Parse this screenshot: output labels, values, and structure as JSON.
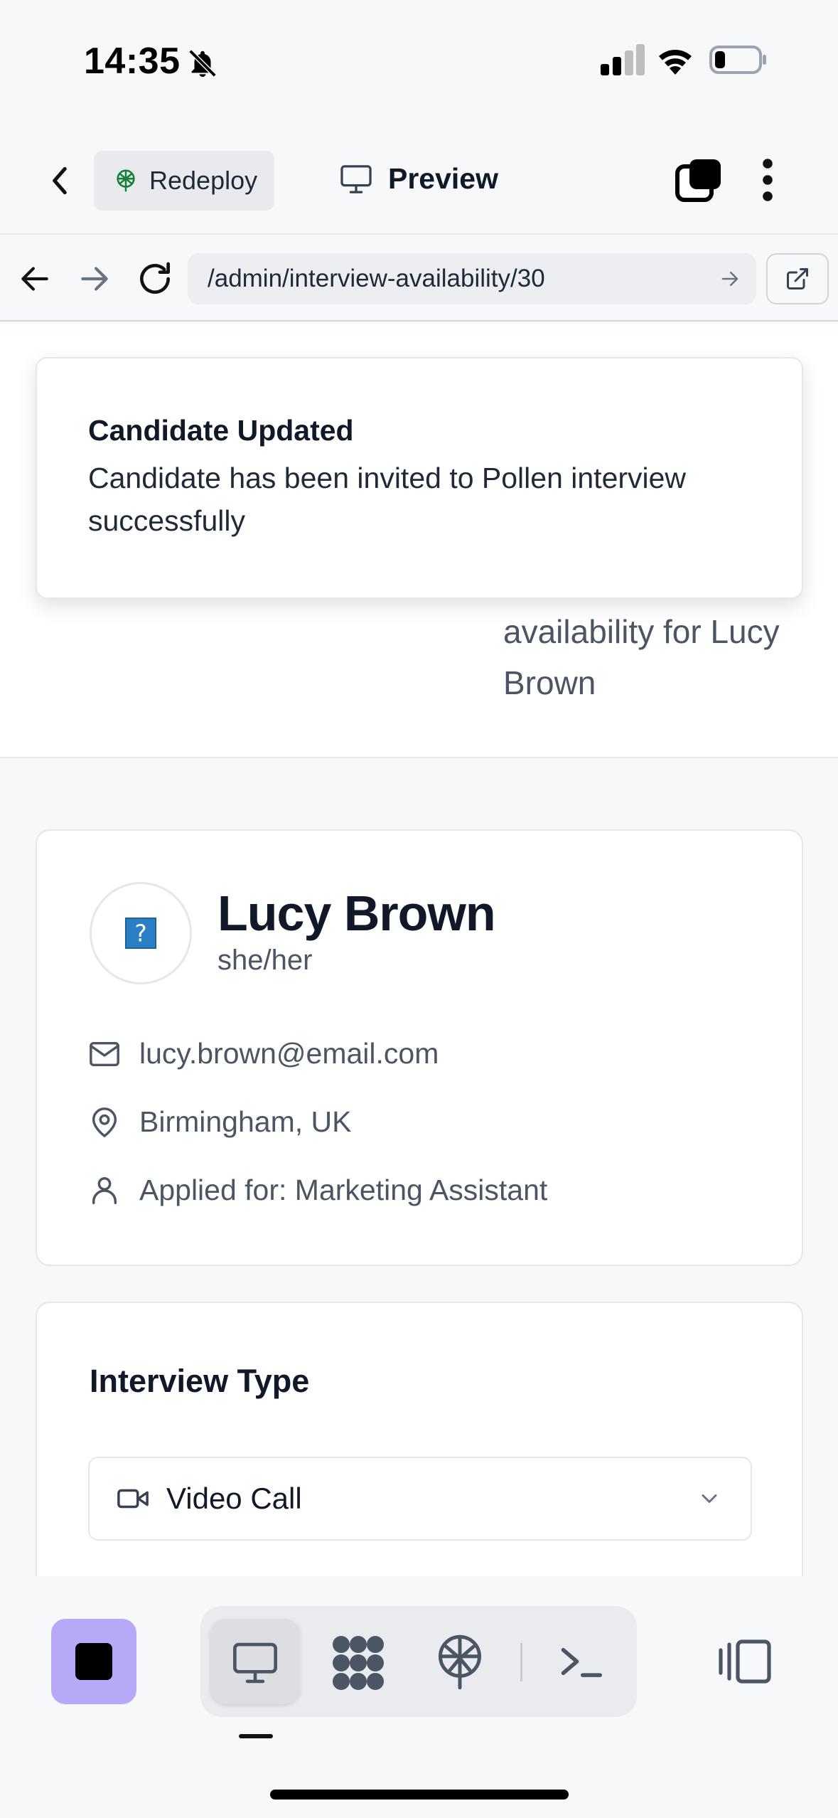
{
  "status_bar": {
    "time": "14:35"
  },
  "header": {
    "redeploy_label": "Redeploy",
    "preview_label": "Preview"
  },
  "browser": {
    "url": "/admin/interview-availability/30"
  },
  "page": {
    "subtitle": "availability for Lucy Brown"
  },
  "candidate": {
    "name": "Lucy Brown",
    "pronouns": "she/her",
    "email": "lucy.brown@email.com",
    "location": "Birmingham, UK",
    "applied_for": "Applied for: Marketing Assistant"
  },
  "interview_type": {
    "title": "Interview Type",
    "selected": "Video Call"
  },
  "toast": {
    "title": "Candidate Updated",
    "message": "Candidate has been invited to Pollen interview successfully"
  },
  "colors": {
    "accent": "#b8a9f8",
    "redeploy_icon": "#15803d",
    "avatar_icon": "#2b7fc4"
  },
  "icons": [
    "bell-slash-icon",
    "signal-icon",
    "wifi-icon",
    "battery-icon",
    "chevron-left-icon",
    "tree-icon",
    "monitor-icon",
    "stacked-squares-icon",
    "more-vertical-icon",
    "arrow-left-icon",
    "arrow-right-icon",
    "refresh-icon",
    "external-link-icon",
    "mail-icon",
    "map-pin-icon",
    "user-icon",
    "video-icon",
    "chevron-down-icon",
    "grid-icon",
    "terminal-icon",
    "panel-icon"
  ]
}
